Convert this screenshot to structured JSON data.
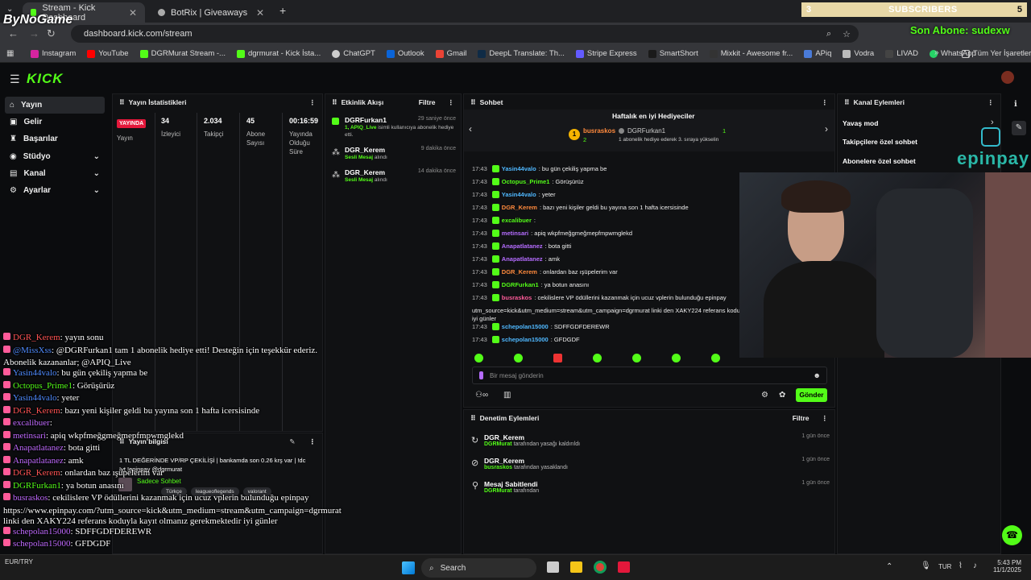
{
  "browser": {
    "tabs": [
      {
        "title": "Stream - Kick Dashboard",
        "active": true
      },
      {
        "title": "BotRix | Giveaways",
        "active": false
      }
    ],
    "url": "dashboard.kick.com/stream",
    "bookmarks": [
      "Instagram",
      "YouTube",
      "DGRMurat Stream -...",
      "dgrmurat - Kick İsta...",
      "ChatGPT",
      "Outlook",
      "Gmail",
      "DeepL Translate: Th...",
      "Stripe Express",
      "SmartShort",
      "Mixkit - Awesome fr...",
      "APiq",
      "Vodra",
      "LIVAD",
      "WhatsApp"
    ],
    "all_bookmarks": "Tüm Yer İşaretleri"
  },
  "overlay": {
    "watermark": "ByNoGame",
    "subscribers_count": "3",
    "subscribers_label": "SUBSCRIBERS",
    "subscribers_goal": "5",
    "last_sub": "Son Abone: sudexw",
    "sponsor": "epinpay"
  },
  "kick": {
    "logo": "KICK",
    "nav": [
      {
        "label": "Yayın",
        "selected": true
      },
      {
        "label": "Gelir"
      },
      {
        "label": "Başarılar"
      },
      {
        "label": "Stüdyo",
        "expandable": true
      },
      {
        "label": "Kanal",
        "expandable": true
      },
      {
        "label": "Ayarlar",
        "expandable": true
      }
    ],
    "stats": {
      "title": "Yayın İstatistikleri",
      "status_badge": "YAYINDA",
      "status_label": "Yayın",
      "viewers": "34",
      "viewers_label": "İzleyici",
      "followers": "2.034",
      "followers_label": "Takipçi",
      "subs": "45",
      "subs_label": "Abone Sayısı",
      "duration": "00:16:59",
      "duration_label": "Yayında Olduğu Süre"
    },
    "activity": {
      "title": "Etkinlik Akışı",
      "filter": "Filtre",
      "items": [
        {
          "name": "DGRFurkan1",
          "time": "29 saniye önce",
          "desc_prefix": "1, APIQ_Live",
          "desc": " isimli kullanıcıya abonelik hediye etti."
        },
        {
          "name": "DGR_Kerem",
          "time": "9 dakika önce",
          "desc_prefix": "Sesli Mesaj",
          "desc": " alındı"
        },
        {
          "name": "DGR_Kerem",
          "time": "14 dakika önce",
          "desc_prefix": "Sesli Mesaj",
          "desc": " alındı"
        }
      ]
    },
    "chat": {
      "title": "Sohbet",
      "gifter_title": "Haftalık en iyi Hediyeciler",
      "gifter_rank": "1",
      "gifter1": "busraskos",
      "gifter1_count": "2",
      "gifter2": "DGRFurkan1",
      "gifter2_count": "1",
      "gifter2_note": "1 abonelik hediye ederek 3. sıraya yükselin",
      "messages": [
        {
          "time": "17:43",
          "user": "Yasin44valo",
          "text": ": bu gün çekiliş yapma be"
        },
        {
          "time": "17:43",
          "user": "Octopus_Prime1",
          "text": ": Görüşürüz"
        },
        {
          "time": "17:43",
          "user": "Yasin44valo",
          "text": ": yeter"
        },
        {
          "time": "17:43",
          "user": "DGR_Kerem",
          "text": ": bazı yeni kişiler geldi bu yayına son 1 hafta icersisinde"
        },
        {
          "time": "17:43",
          "user": "excalibuer",
          "text": ":"
        },
        {
          "time": "17:43",
          "user": "metinsari",
          "text": ": apiq wkpfmeğgmeğmepfmpwmglekd"
        },
        {
          "time": "17:43",
          "user": "Anapatlatanez",
          "text": ": bota gitti"
        },
        {
          "time": "17:43",
          "user": "Anapatlatanez",
          "text": ": amk"
        },
        {
          "time": "17:43",
          "user": "DGR_Kerem",
          "text": ": onlardan baz ışüpelerim var"
        },
        {
          "time": "17:43",
          "user": "DGRFurkan1",
          "text": ": ya botun anasını"
        },
        {
          "time": "17:43",
          "user": "busraskos",
          "text": ": cekilislere VP ödüllerini kazanmak için ucuz vplerin bulunduğu epinpay"
        },
        {
          "time": "",
          "user": "",
          "text": "utm_source=kick&utm_medium=stream&utm_campaign=dgrmurat linki den XAKY224 referans koduyl"
        },
        {
          "time": "",
          "user": "",
          "text": "iyi günler"
        },
        {
          "time": "17:43",
          "user": "schepolan15000",
          "text": ": SDFFGDFDEREWR"
        },
        {
          "time": "17:43",
          "user": "schepolan15000",
          "text": ": GFDGDF"
        }
      ],
      "input_placeholder": "Bir mesaj gönderin",
      "send": "Gönder"
    },
    "channel_actions": {
      "title": "Kanal Eylemleri",
      "items": [
        "Yavaş mod",
        "Takipçilere özel sohbet",
        "Abonelere özel sohbet"
      ]
    },
    "stream_info": {
      "title": "Yayın bilgisi",
      "desc": "1 TL DEĞERİNDE VP/RP ÇEKİLİŞİ | bankamda son 0.26 krş var | !dc !yt !epinpay @dgrmurat",
      "mode": "Sadece Sohbet",
      "tags": [
        "Türkçe",
        "leagueoflegends",
        "valorant"
      ]
    },
    "moderation": {
      "title": "Denetim Eylemleri",
      "filter": "Filtre",
      "items": [
        {
          "name": "DGR_Kerem",
          "by": "DGRMurat",
          "action": " tarafından yasağı kaldırıldı",
          "time": "1 gün önce"
        },
        {
          "name": "DGR_Kerem",
          "by": "busraskos",
          "action": " tarafından yasaklandı",
          "time": "1 gün önce"
        },
        {
          "name": "Mesaj Sabitlendi",
          "by": "DGRMurat",
          "action": " tarafından",
          "time": "1 gün önce"
        }
      ]
    }
  },
  "overlay_chat": [
    {
      "user": "DGR_Kerem",
      "text": " yayın sonu"
    },
    {
      "user": "@MissXss",
      "text": " @DGRFurkan1 tam 1 abonelik hediye etti! Desteğin için teşekkür ederiz."
    },
    {
      "user": "",
      "text": "Abonelik kazananlar; @APIQ_Live"
    },
    {
      "user": "Yasin44valo",
      "text": " bu gün çekiliş yapma be"
    },
    {
      "user": "Octopus_Prime1",
      "text": " Görüşürüz"
    },
    {
      "user": "Yasin44valo",
      "text": " yeter"
    },
    {
      "user": "DGR_Kerem",
      "text": " bazı yeni kişiler geldi bu yayına son 1 hafta icersisinde"
    },
    {
      "user": "excalibuer",
      "text": ""
    },
    {
      "user": "metinsari",
      "text": " apiq wkpfmeğgmeğmepfmpwmglekd"
    },
    {
      "user": "Anapatlatanez",
      "text": " bota gitti"
    },
    {
      "user": "Anapatlatanez",
      "text": " amk"
    },
    {
      "user": "DGR_Kerem",
      "text": " onlardan baz ışüpelerim var"
    },
    {
      "user": "DGRFurkan1",
      "text": " ya botun anasını"
    },
    {
      "user": "busraskos",
      "text": " cekilislere VP ödüllerini kazanmak için ucuz vplerin bulunduğu epinpay"
    },
    {
      "user": "",
      "text": "https://www.epinpay.com/?utm_source=kick&utm_medium=stream&utm_campaign=dgrmurat"
    },
    {
      "user": "",
      "text": "linki den XAKY224 referans koduyla kayıt olmanız gerekmektedir iyi günler"
    },
    {
      "user": "schepolan15000",
      "text": " SDFFGDFDEREWR"
    },
    {
      "user": "schepolan15000",
      "text": " GFDGDF"
    }
  ],
  "taskbar": {
    "search": "Search",
    "ticker": "EUR/TRY",
    "lang": "TUR",
    "time": "5:43 PM",
    "date": "11/1/2025"
  }
}
